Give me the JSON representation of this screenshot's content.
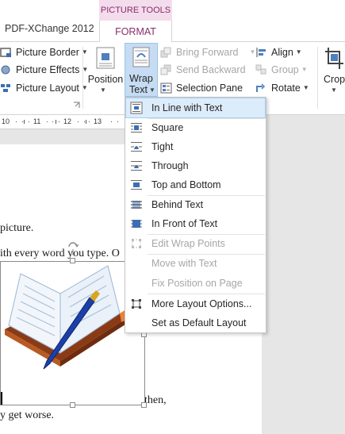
{
  "tabs": {
    "app_tab": "PDF-XChange 2012",
    "tool_group": "PICTURE TOOLS",
    "format_tab": "FORMAT"
  },
  "ribbon": {
    "picture_border": "Picture Border",
    "picture_effects": "Picture Effects",
    "picture_layout": "Picture Layout",
    "position": "Position",
    "wrap_text_line1": "Wrap",
    "wrap_text_line2": "Text",
    "bring_forward": "Bring Forward",
    "send_backward": "Send Backward",
    "selection_pane": "Selection Pane",
    "align": "Align",
    "group": "Group",
    "rotate": "Rotate",
    "crop": "Crop"
  },
  "ruler": {
    "labels": [
      "10",
      "11",
      "12",
      "13"
    ]
  },
  "document": {
    "line1": "picture.",
    "line2": "ith every word you type. O",
    "line3": "then,",
    "line4": "y get worse."
  },
  "wrap_menu": {
    "items": [
      {
        "label": "In Line with Text",
        "icon": "inline-text-icon",
        "enabled": true,
        "selected": true
      },
      {
        "label": "Square",
        "icon": "square-wrap-icon",
        "enabled": true
      },
      {
        "label": "Tight",
        "icon": "tight-wrap-icon",
        "enabled": true
      },
      {
        "label": "Through",
        "icon": "through-wrap-icon",
        "enabled": true
      },
      {
        "label": "Top and Bottom",
        "icon": "top-bottom-wrap-icon",
        "enabled": true
      },
      {
        "label": "Behind Text",
        "icon": "behind-text-icon",
        "enabled": true
      },
      {
        "label": "In Front of Text",
        "icon": "in-front-text-icon",
        "enabled": true
      },
      {
        "label": "Edit Wrap Points",
        "icon": "edit-wrap-points-icon",
        "enabled": false
      },
      {
        "label": "Move with Text",
        "icon": "",
        "enabled": false
      },
      {
        "label": "Fix Position on Page",
        "icon": "",
        "enabled": false
      },
      {
        "label": "More Layout Options...",
        "icon": "layout-options-icon",
        "enabled": true
      },
      {
        "label": "Set as Default Layout",
        "icon": "",
        "enabled": true
      }
    ]
  },
  "colors": {
    "accent": "#8b2d6b",
    "tool_header_bg": "#f3dceb",
    "selection_bg": "#dcecfb",
    "disabled_text": "#a6a6a6"
  }
}
